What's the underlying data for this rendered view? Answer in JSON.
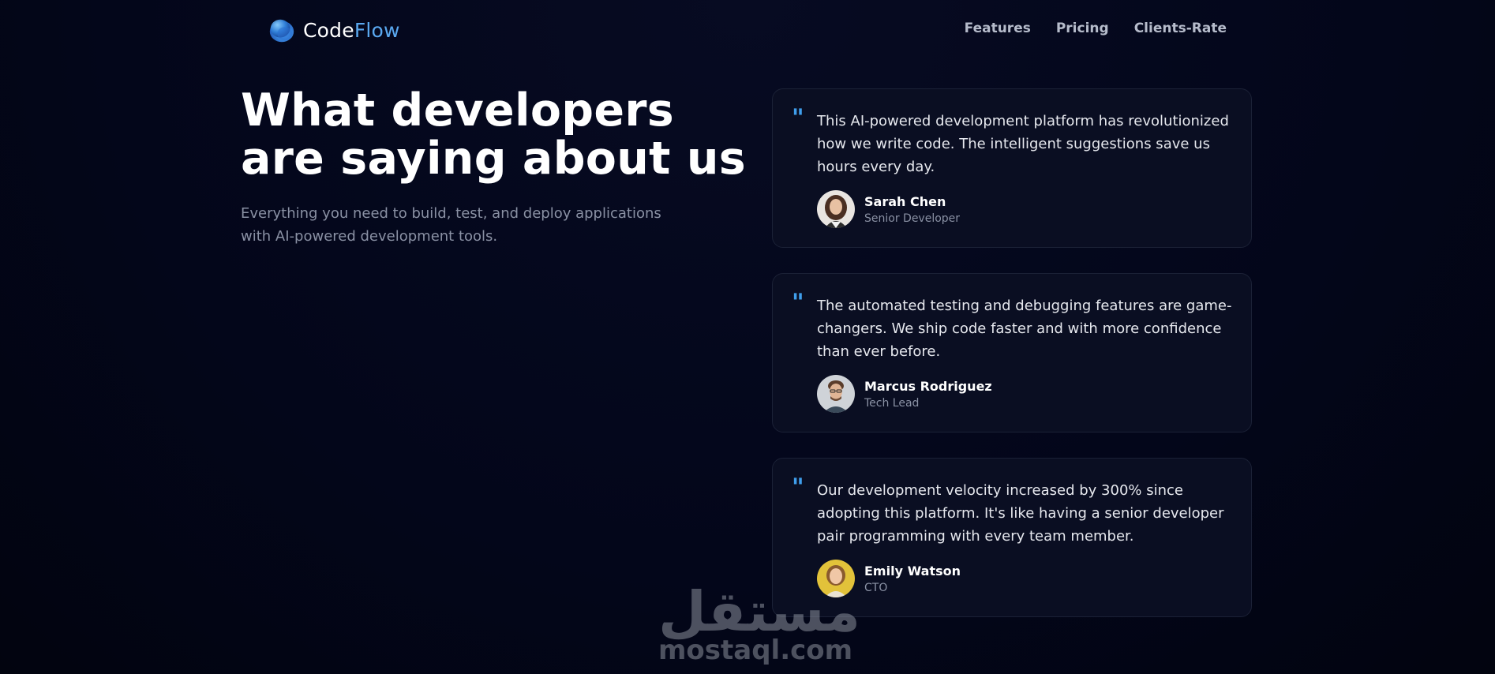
{
  "brand": {
    "name_part1": "Code",
    "name_part2": "Flow",
    "accent_color": "#5aa8f0",
    "logo_icon": "blue-orb-icon"
  },
  "nav": {
    "links": [
      {
        "label": "Features"
      },
      {
        "label": "Pricing"
      },
      {
        "label": "Clients-Rate"
      }
    ]
  },
  "hero": {
    "title": "What developers are saying about us",
    "subtitle": "Everything you need to build, test, and deploy applications with AI-powered development tools."
  },
  "testimonials": [
    {
      "quote": "This AI-powered development platform has revolutionized how we write code. The intelligent suggestions save us hours every day.",
      "name": "Sarah Chen",
      "role": "Senior Developer",
      "avatar_icon": "avatar-woman-icon"
    },
    {
      "quote": "The automated testing and debugging features are game-changers. We ship code faster and with more confidence than ever before.",
      "name": "Marcus Rodriguez",
      "role": "Tech Lead",
      "avatar_icon": "avatar-man-icon"
    },
    {
      "quote": "Our development velocity increased by 300% since adopting this platform. It's like having a senior developer pair programming with every team member.",
      "name": "Emily Watson",
      "role": "CTO",
      "avatar_icon": "avatar-woman-icon"
    }
  ],
  "quote_mark": "\"",
  "watermark": {
    "arabic": "مستقل",
    "latin": "mostaql.com"
  },
  "colors": {
    "background": "#03061a",
    "card_bg": "#0a0e22",
    "quote_accent": "#3f9eec",
    "muted_text": "#8a91a4"
  }
}
